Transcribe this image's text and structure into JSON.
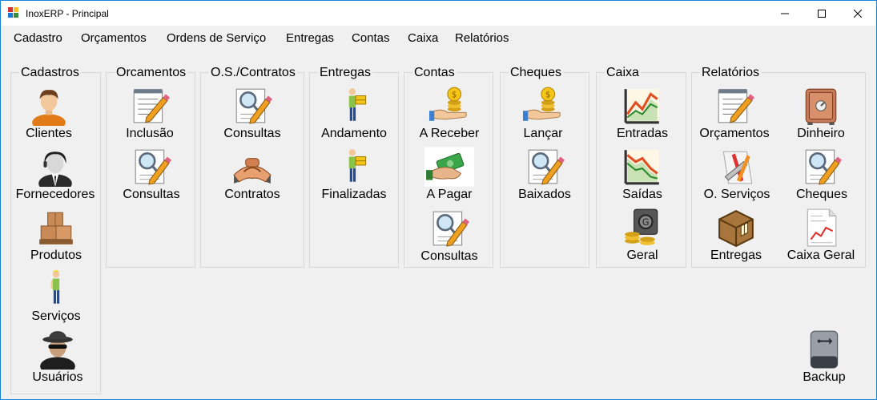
{
  "window": {
    "title": "InoxERP - Principal"
  },
  "menu": [
    "Cadastro",
    "Orçamentos",
    "Ordens de Serviço",
    "Entregas",
    "Contas",
    "Caixa",
    "Relatórios"
  ],
  "groups": {
    "cadastros": {
      "title": "Cadastros",
      "items": [
        "Clientes",
        "Fornecedores",
        "Produtos",
        "Serviços",
        "Usuários"
      ]
    },
    "orcamentos": {
      "title": "Orcamentos",
      "items": [
        "Inclusão",
        "Consultas"
      ]
    },
    "os": {
      "title": "O.S./Contratos",
      "items": [
        "Consultas",
        "Contratos"
      ]
    },
    "entregas": {
      "title": "Entregas",
      "items": [
        "Andamento",
        "Finalizadas"
      ]
    },
    "contas": {
      "title": "Contas",
      "items": [
        "A Receber",
        "A Pagar",
        "Consultas"
      ]
    },
    "cheques": {
      "title": "Cheques",
      "items": [
        "Lançar",
        "Baixados"
      ]
    },
    "caixa": {
      "title": "Caixa",
      "items": [
        "Entradas",
        "Saídas",
        "Geral"
      ]
    },
    "relatorios": {
      "title": "Relatórios",
      "items": [
        "Orçamentos",
        "Dinheiro",
        "O. Serviços",
        "Cheques",
        "Entregas",
        "Caixa Geral"
      ]
    }
  },
  "backup": {
    "label": "Backup"
  },
  "icons": {
    "clientes": "person-icon",
    "fornecedores": "supplier-icon",
    "produtos": "boxes-icon",
    "servicos": "worker-icon",
    "usuarios": "spy-user-icon",
    "notepad": "notepad-pencil-icon",
    "search": "magnifier-document-icon",
    "handshake": "handshake-icon",
    "delivery": "delivery-man-icon",
    "coin-hand": "coin-hand-icon",
    "money-pay": "money-hand-icon",
    "chart-up": "chart-up-icon",
    "chart-down": "chart-down-icon",
    "safe": "safe-icon",
    "coins": "coins-safe-icon",
    "tools": "tools-icon",
    "crate": "crate-icon",
    "report": "report-document-icon",
    "drive": "usb-drive-icon"
  },
  "colors": {
    "window_border": "#1883d7",
    "background": "#f0f0f0",
    "group_border": "#d8d8d8"
  }
}
